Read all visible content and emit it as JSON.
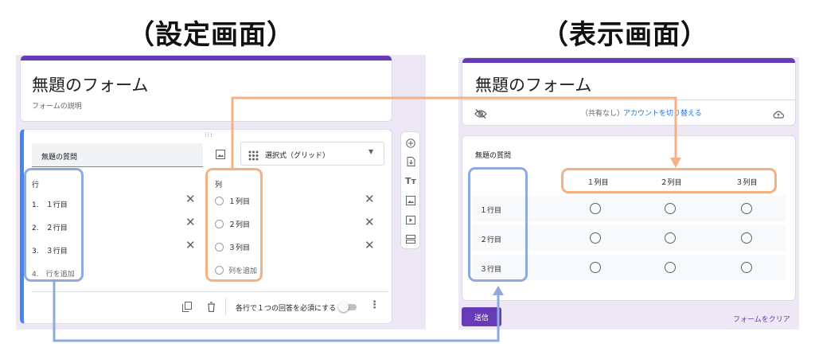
{
  "headings": {
    "left": "（設定画面）",
    "right": "（表示画面）"
  },
  "colors": {
    "accent": "#673ab7",
    "blue_highlight": "#8faadc",
    "orange_highlight": "#f4b183",
    "panel_bg": "#ede7f6"
  },
  "settings": {
    "form_title": "無題のフォーム",
    "form_description": "フォームの説明",
    "question_title": "無題の質問",
    "question_type": "選択式（グリッド）",
    "rows_header": "行",
    "rows": [
      {
        "num": "1.",
        "label": "１行目"
      },
      {
        "num": "2.",
        "label": "２行目"
      },
      {
        "num": "3.",
        "label": "３行目"
      }
    ],
    "add_row": {
      "num": "4.",
      "label": "行を追加"
    },
    "columns_header": "列",
    "columns": [
      "１列目",
      "２列目",
      "３列目"
    ],
    "add_column": "列を追加",
    "require_label": "各行で１つの回答を必須にする",
    "icons": {
      "image": "image-icon",
      "type_grid": "grid-icon",
      "dropdown": "chevron-down-icon",
      "copy": "copy-icon",
      "delete": "trash-icon",
      "more": "more-vert-icon",
      "drag": "drag-handle-icon"
    },
    "toolbar_icons": [
      "add-question-icon",
      "import-questions-icon",
      "add-title-icon",
      "add-image-icon",
      "add-video-icon",
      "add-section-icon"
    ]
  },
  "preview": {
    "form_title": "無題のフォーム",
    "share_status": "（共有なし）",
    "switch_account": "アカウントを切り替える",
    "question_title": "無題の質問",
    "columns": [
      "１列目",
      "２列目",
      "３列目"
    ],
    "rows": [
      "１行目",
      "２行目",
      "３行目"
    ],
    "submit_label": "送信",
    "clear_label": "フォームをクリア",
    "icons": {
      "not_shared": "eye-off-icon",
      "cloud": "cloud-icon"
    }
  }
}
